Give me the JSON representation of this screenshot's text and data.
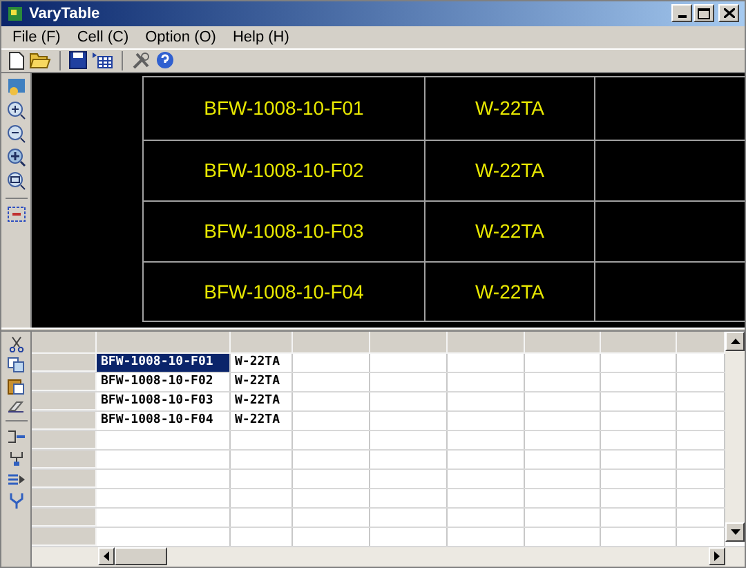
{
  "window": {
    "title": "VaryTable"
  },
  "menu": [
    {
      "label": "File (F)"
    },
    {
      "label": "Cell (C)"
    },
    {
      "label": "Option (O)"
    },
    {
      "label": "Help (H)"
    }
  ],
  "canvas": {
    "rows": [
      {
        "cells": [
          "BFW-1008-10-F01",
          "W-22TA"
        ]
      },
      {
        "cells": [
          "BFW-1008-10-F02",
          "W-22TA"
        ]
      },
      {
        "cells": [
          "BFW-1008-10-F03",
          "W-22TA"
        ]
      },
      {
        "cells": [
          "BFW-1008-10-F04",
          "W-22TA"
        ]
      }
    ]
  },
  "grid": {
    "rows": [
      {
        "cells": [
          {
            "text": "BFW-1008-10-F01",
            "selected": true
          },
          {
            "text": "W-22TA",
            "selected": false
          }
        ]
      },
      {
        "cells": [
          {
            "text": "BFW-1008-10-F02",
            "selected": false
          },
          {
            "text": "W-22TA",
            "selected": false
          }
        ]
      },
      {
        "cells": [
          {
            "text": "BFW-1008-10-F03",
            "selected": false
          },
          {
            "text": "W-22TA",
            "selected": false
          }
        ]
      },
      {
        "cells": [
          {
            "text": "BFW-1008-10-F04",
            "selected": false
          },
          {
            "text": "W-22TA",
            "selected": false
          }
        ]
      }
    ]
  }
}
